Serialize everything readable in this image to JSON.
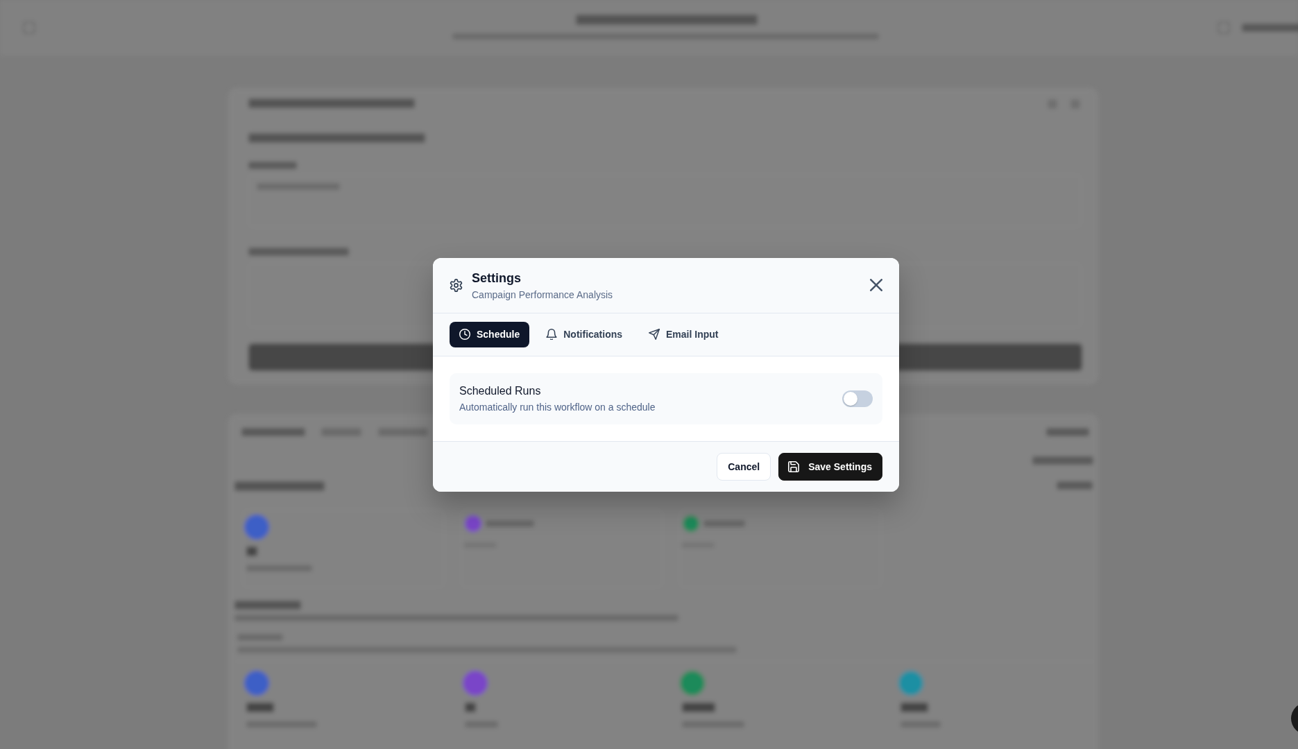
{
  "dialog": {
    "title": "Settings",
    "subtitle": "Campaign Performance Analysis"
  },
  "tabs": [
    {
      "label": "Schedule",
      "selected": true
    },
    {
      "label": "Notifications",
      "selected": false
    },
    {
      "label": "Email Input",
      "selected": false
    }
  ],
  "settings": [
    {
      "title": "Scheduled Runs",
      "description": "Automatically run this workflow on a schedule",
      "on": false
    }
  ],
  "buttons": [
    {
      "label": "Cancel",
      "kind": "secondary"
    },
    {
      "label": "Save Settings",
      "kind": "primary"
    }
  ]
}
